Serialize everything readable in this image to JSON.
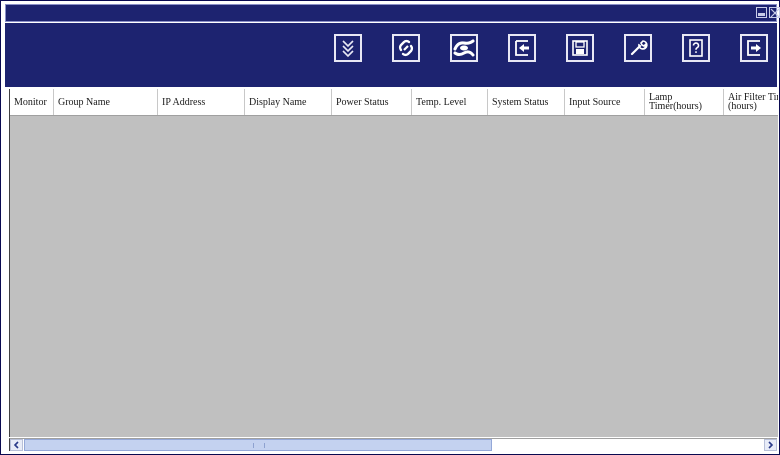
{
  "window": {
    "title": "",
    "controls": [
      "minimize-icon",
      "close-icon"
    ]
  },
  "toolbar": {
    "buttons": [
      {
        "name": "expand-down-icon"
      },
      {
        "name": "connect-icon"
      },
      {
        "name": "disconnect-icon"
      },
      {
        "name": "import-icon"
      },
      {
        "name": "save-icon"
      },
      {
        "name": "wrench-icon"
      },
      {
        "name": "help-icon"
      },
      {
        "name": "exit-icon"
      }
    ]
  },
  "table": {
    "columns": [
      "Monitor",
      "Group Name",
      "IP Address",
      "Display Name",
      "Power Status",
      "Temp. Level",
      "System Status",
      "Input Source",
      "Lamp Timer(hours)",
      "Air Filter Timer (hours)"
    ],
    "rows": []
  },
  "colors": {
    "toolbar_bg": "#1d2370",
    "grid_bg": "#c0c0c0",
    "scroll_thumb": "#c4d2f0"
  }
}
